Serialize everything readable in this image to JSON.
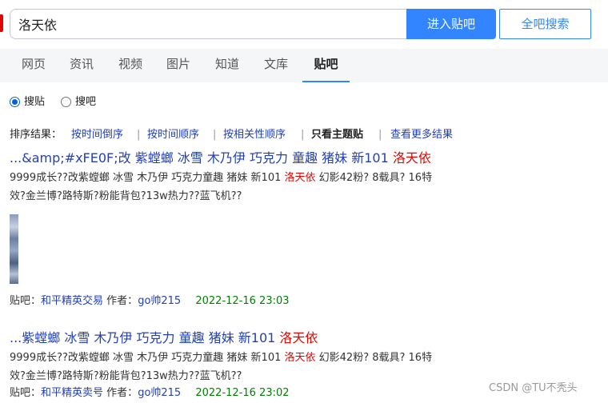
{
  "search": {
    "query": "洛天依",
    "enter_button": "进入贴吧",
    "all_button": "全吧搜索"
  },
  "nav": {
    "tabs": [
      "网页",
      "资讯",
      "视频",
      "图片",
      "知道",
      "文库",
      "贴吧"
    ],
    "active": "贴吧"
  },
  "radios": {
    "posts": "搜贴",
    "bars": "搜吧",
    "selected": "搜贴"
  },
  "sort": {
    "label": "排序结果：",
    "by_time_desc": "按时间倒序",
    "sep": "|",
    "by_time_asc": "按时间顺序",
    "by_relevance": "按相关性顺序",
    "only_topic": "只看主题贴",
    "more": "查看更多结果"
  },
  "results": [
    {
      "title_prefix": "...&amp;#xFE0F;改 紫螳螂 冰雪 木乃伊 巧克力 童趣 猪妹 新101 ",
      "title_highlight": "洛天依",
      "snippet_line1_prefix": "9999成长??改紫螳螂 冰雪 木乃伊 巧克力童趣 猪妹 新101 ",
      "snippet_highlight": "洛天依",
      "snippet_line1_suffix": " 幻影42粉? 8载具? 16特",
      "snippet_line2": "效?金兰博?路特斯?粉能背包?13w热力??蓝飞机??",
      "bar_label": "贴吧：",
      "bar_name": "和平精英交易",
      "author_label": "作者：",
      "author": "go帅215",
      "date": "2022-12-16 23:03"
    },
    {
      "title_prefix": "...紫螳螂 冰雪 木乃伊 巧克力 童趣 猪妹 新101 ",
      "title_highlight": "洛天依",
      "snippet_line1_prefix": "9999成长??改紫螳螂 冰雪 木乃伊 巧克力童趣 猪妹 新101 ",
      "snippet_highlight": "洛天依",
      "snippet_line1_suffix": " 幻影42粉? 8载具? 16特",
      "snippet_line2": "效?金兰博?路特斯?粉能背包?13w热力??蓝飞机??",
      "bar_label": "贴吧：",
      "bar_name": "和平精英卖号",
      "author_label": "作者：",
      "author": "go帅215",
      "date": "2022-12-16 23:02"
    }
  ],
  "watermark": "CSDN @TU不秃头",
  "colors": {
    "accent": "#3385ff",
    "link": "#2440b3",
    "highlight": "#e10601",
    "date": "#008000"
  }
}
